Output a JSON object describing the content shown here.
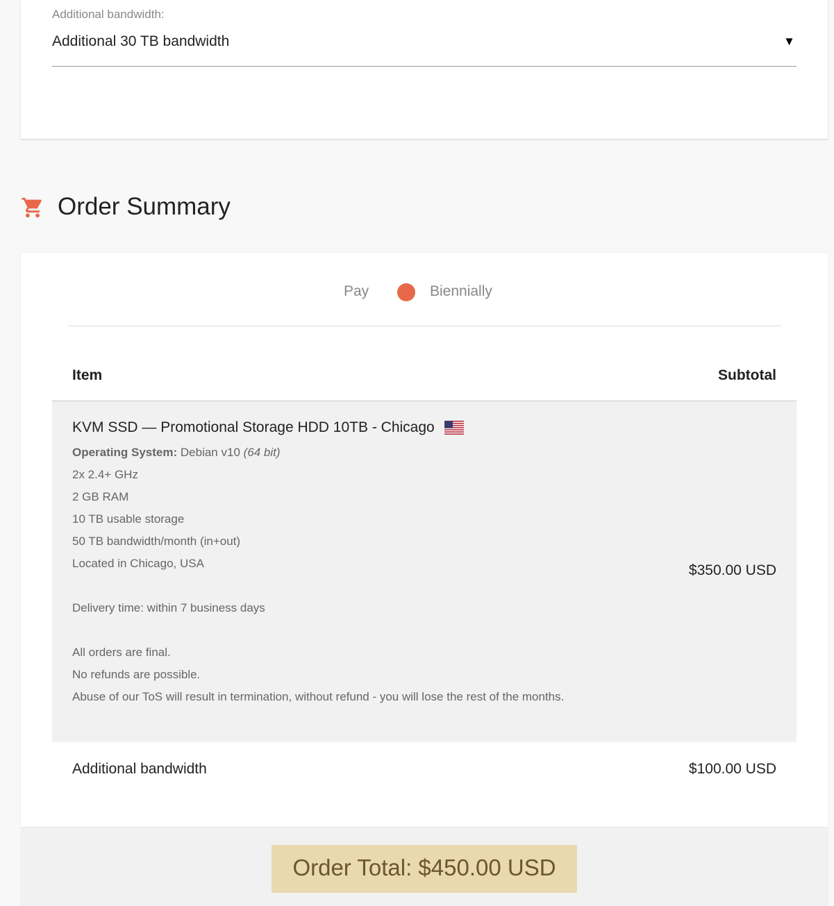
{
  "bandwidth": {
    "label": "Additional bandwidth:",
    "selected": "Additional 30 TB bandwidth",
    "arrow": "▼"
  },
  "summary": {
    "title": "Order Summary",
    "icon": "cart-icon",
    "accent_color": "#e8684a"
  },
  "billing": {
    "pay_label": "Pay",
    "period": "Biennially"
  },
  "table": {
    "headers": {
      "item": "Item",
      "subtotal": "Subtotal"
    },
    "main_item": {
      "name": "KVM SSD — Promotional Storage HDD 10TB - Chicago",
      "flag": "us-flag-icon",
      "os_label": "Operating System:",
      "os_value": "Debian v10",
      "os_arch": "(64 bit)",
      "specs": [
        "2x 2.4+ GHz",
        "2 GB RAM",
        "10 TB usable storage",
        "50 TB bandwidth/month (in+out)",
        "Located in Chicago, USA"
      ],
      "delivery": "Delivery time: within 7 business days",
      "terms": [
        "All orders are final.",
        "No refunds are possible.",
        "Abuse of our ToS will result in termination, without refund - you will lose the rest of the months."
      ],
      "price": "$350.00 USD"
    },
    "extra_item": {
      "name": "Additional bandwidth",
      "price": "$100.00 USD"
    }
  },
  "total": {
    "label": "Order Total: $450.00 USD",
    "color": "#ead9ae"
  }
}
